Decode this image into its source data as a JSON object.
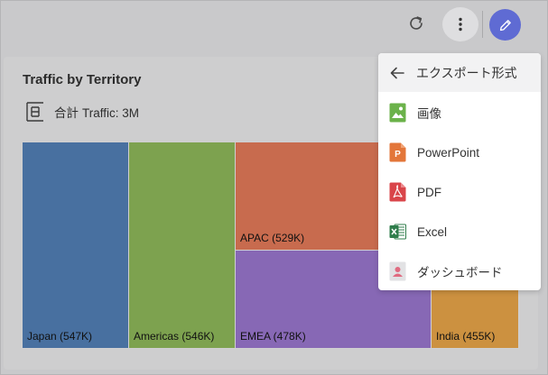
{
  "toolbar": {
    "refresh_icon": "refresh-icon",
    "more_icon": "more-vertical-icon",
    "edit_icon": "pencil-icon",
    "accent": "#5f6bd3"
  },
  "card": {
    "title": "Traffic by Territory",
    "summary_icon": "tree-structure-icon",
    "summary_prefix": "合計",
    "summary_text": "Traffic: 3M"
  },
  "chart_data": {
    "type": "treemap",
    "series": [
      {
        "name": "Japan",
        "value": 547,
        "label": "Japan (547K)",
        "color": "#4870a0"
      },
      {
        "name": "Americas",
        "value": 546,
        "label": "Americas (546K)",
        "color": "#7da24f"
      },
      {
        "name": "APAC",
        "value": 529,
        "label": "APAC (529K)",
        "color": "#c86b4e"
      },
      {
        "name": "EMEA",
        "value": 478,
        "label": "EMEA (478K)",
        "color": "#8768b5"
      },
      {
        "name": "India",
        "value": 455,
        "label": "India (455K)",
        "color": "#cc9140"
      }
    ]
  },
  "export_menu": {
    "header": "エクスポート形式",
    "items": [
      {
        "label": "画像",
        "icon": "image-icon",
        "color": "#6bb24a"
      },
      {
        "label": "PowerPoint",
        "icon": "powerpoint-icon",
        "color": "#e3763a"
      },
      {
        "label": "PDF",
        "icon": "pdf-icon",
        "color": "#d9454a"
      },
      {
        "label": "Excel",
        "icon": "excel-icon",
        "color": "#2f7d4b"
      },
      {
        "label": "ダッシュボード",
        "icon": "dashboard-icon",
        "color": "#e06b80"
      }
    ]
  }
}
